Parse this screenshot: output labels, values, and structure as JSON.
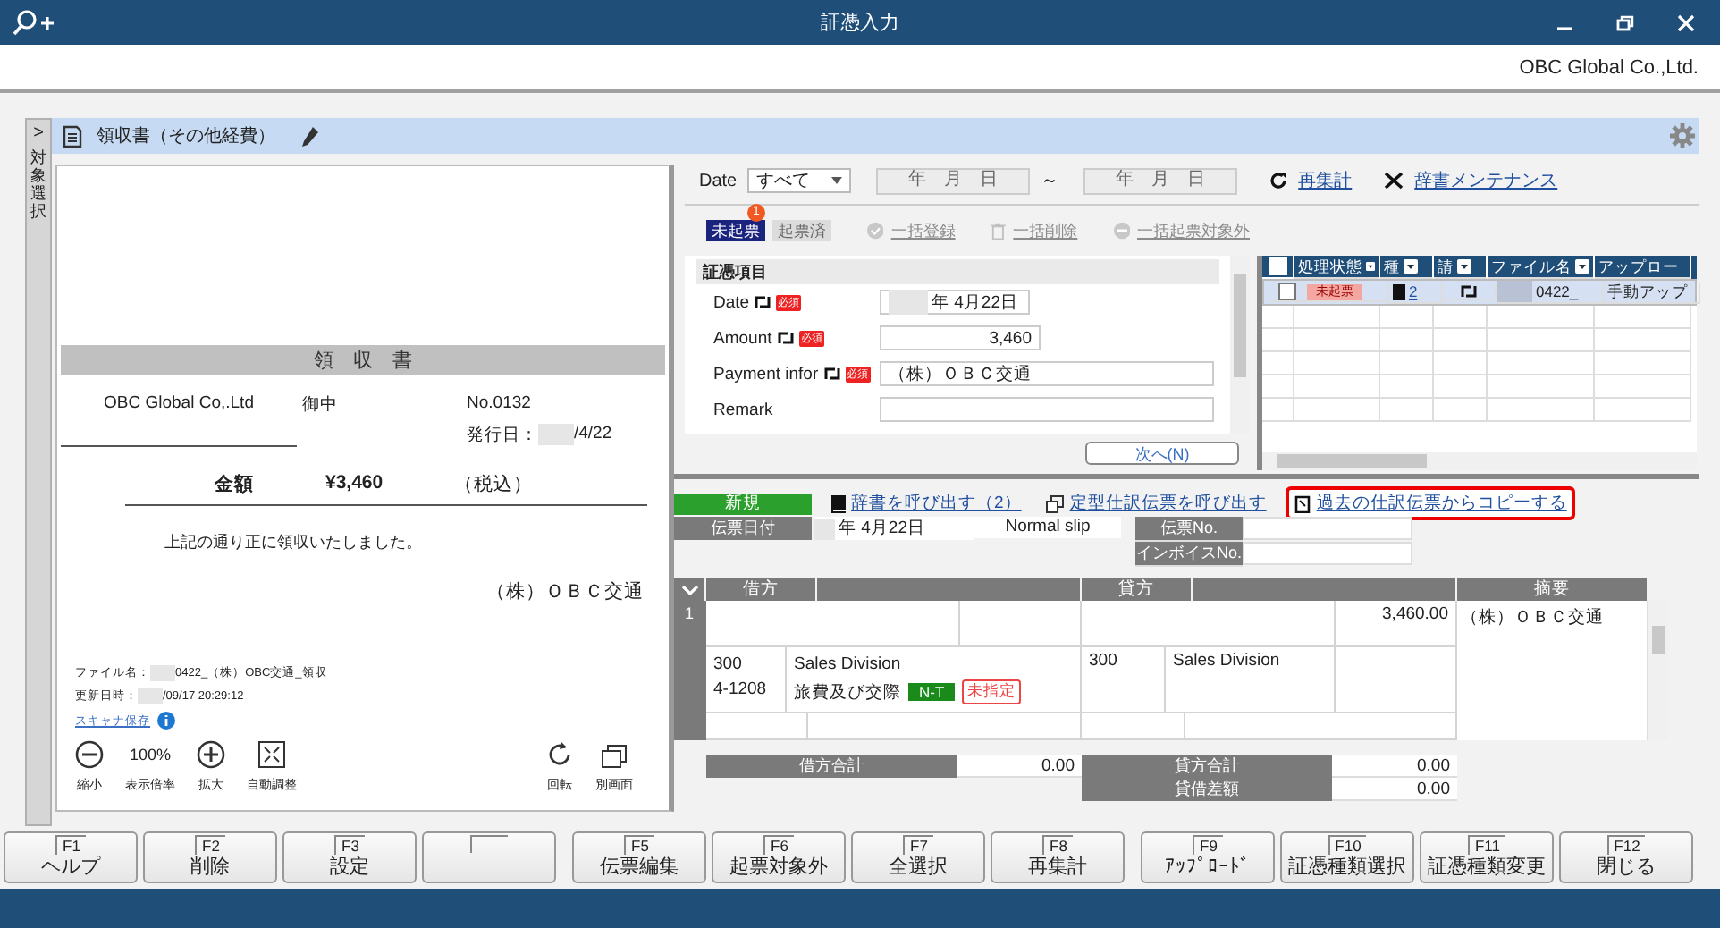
{
  "window": {
    "title": "証憑入力"
  },
  "company": "OBC Global Co.,Ltd.",
  "sidebar": {
    "toggle": ">",
    "label": "対象選択"
  },
  "document": {
    "title": "領収書（その他経費）"
  },
  "receipt": {
    "heading": "領　収　書",
    "recipient": "OBC Global Co,.Ltd",
    "honorific": "御中",
    "number": "No.0132",
    "issue_label": "発行日：",
    "issue_date": "/4/22",
    "issue_redacted": true,
    "amount_label": "金額",
    "amount": "¥3,460",
    "tax_note": "（税込）",
    "message": "上記の通り正に領収いたしました。",
    "issuer": "（株）ＯＢＣ交通"
  },
  "file_info": {
    "file_label": "ファイル名：",
    "file_name": "0422_（株）OBC交通_領収",
    "updated_label": "更新日時：",
    "updated": "/09/17 20:29:12",
    "redacted": true,
    "scanner_link": "スキャナ保存"
  },
  "viewer_tools": [
    {
      "kind": "minus",
      "label": "縮小"
    },
    {
      "kind": "value",
      "value": "100%",
      "label": "表示倍率"
    },
    {
      "kind": "plus",
      "label": "拡大"
    },
    {
      "kind": "fit",
      "label": "自動調整"
    },
    {
      "kind": "rotate",
      "label": "回転"
    },
    {
      "kind": "window",
      "label": "別画面"
    }
  ],
  "filter": {
    "date_label": "Date",
    "date_select": "すべて",
    "date_from": "年　月　日",
    "separator": "～",
    "date_to": "年　月　日",
    "links": [
      {
        "label": "再集計"
      },
      {
        "label": "辞書メンテナンス"
      }
    ]
  },
  "status_tabs": [
    {
      "label": "未起票",
      "selected": true,
      "badge": "1"
    },
    {
      "label": "起票済",
      "selected": false
    }
  ],
  "bulk_actions": [
    {
      "label": "一括登録",
      "disabled": true
    },
    {
      "label": "一括削除",
      "disabled": true
    },
    {
      "label": "一括起票対象外",
      "disabled": true
    }
  ],
  "form": {
    "section": "証憑項目",
    "fields": [
      {
        "label": "Date",
        "linked": true,
        "required": "必須",
        "value": "年  4月22日",
        "redacted": true,
        "kind": "date"
      },
      {
        "label": "Amount",
        "linked": true,
        "required": "必須",
        "value": "3,460",
        "kind": "number"
      },
      {
        "label": "Payment infor",
        "linked": true,
        "required": "必須",
        "value": "（株）ＯＢＣ交通",
        "kind": "text"
      },
      {
        "label": "Remark",
        "kind": "text"
      }
    ],
    "next_button": "次へ(N)"
  },
  "file_table": {
    "all_checked": false,
    "columns": [
      "処理状態",
      "種",
      "請",
      "ファイル名",
      "アップロー"
    ],
    "rows": [
      {
        "checked": false,
        "selected": true,
        "status": "未起票",
        "count": "2",
        "linked": true,
        "file_name": "0422_",
        "redacted": true,
        "upload": "手動アップ"
      }
    ]
  },
  "journal": {
    "mode": "新規",
    "links": [
      {
        "label": "辞書を呼び出す（2）",
        "highlighted": false
      },
      {
        "label": "定型仕訳伝票を呼び出す",
        "highlighted": false
      },
      {
        "label": "過去の仕訳伝票からコピーする",
        "highlighted": true
      }
    ],
    "date_label": "伝票日付",
    "date": "年  4月22日",
    "date_redacted": true,
    "slip_type": "Normal slip",
    "slip_no_label": "伝票No.",
    "invoice_no_label": "インボイスNo.",
    "headers": {
      "debit": "借方",
      "credit": "貸方",
      "memo": "摘要"
    },
    "lines": [
      {
        "number": "1",
        "amount": "3,460.00",
        "memo": "（株）ＯＢＣ交通",
        "debit_code": "300",
        "debit_sub": "4-1208",
        "debit_dept": "Sales Division",
        "debit_account": "旅費及び交際",
        "tax_tag": "N-T",
        "unassigned_tag": "未指定",
        "credit_code": "300",
        "credit_dept": "Sales Division"
      }
    ],
    "totals": {
      "debit_label": "借方合計",
      "debit": "0.00",
      "credit_label": "貸方合計",
      "credit": "0.00",
      "diff_label": "貸借差額",
      "diff": "0.00"
    }
  },
  "function_keys": [
    {
      "kind": "key",
      "key": "F1",
      "label": "ヘルプ"
    },
    {
      "kind": "key",
      "key": "F2",
      "label": "削除"
    },
    {
      "kind": "key",
      "key": "F3",
      "label": "設定"
    },
    {
      "kind": "blank"
    },
    {
      "kind": "key",
      "key": "F5",
      "label": "伝票編集"
    },
    {
      "kind": "key",
      "key": "F6",
      "label": "起票対象外"
    },
    {
      "kind": "key",
      "key": "F7",
      "label": "全選択"
    },
    {
      "kind": "key",
      "key": "F8",
      "label": "再集計"
    },
    {
      "kind": "key",
      "key": "F9",
      "label": "ｱｯﾌﾟﾛｰﾄﾞ"
    },
    {
      "kind": "key",
      "key": "F10",
      "label": "証憑種類選択"
    },
    {
      "kind": "key",
      "key": "F11",
      "label": "証憑種類変更"
    },
    {
      "kind": "key",
      "key": "F12",
      "label": "閉じる"
    }
  ]
}
